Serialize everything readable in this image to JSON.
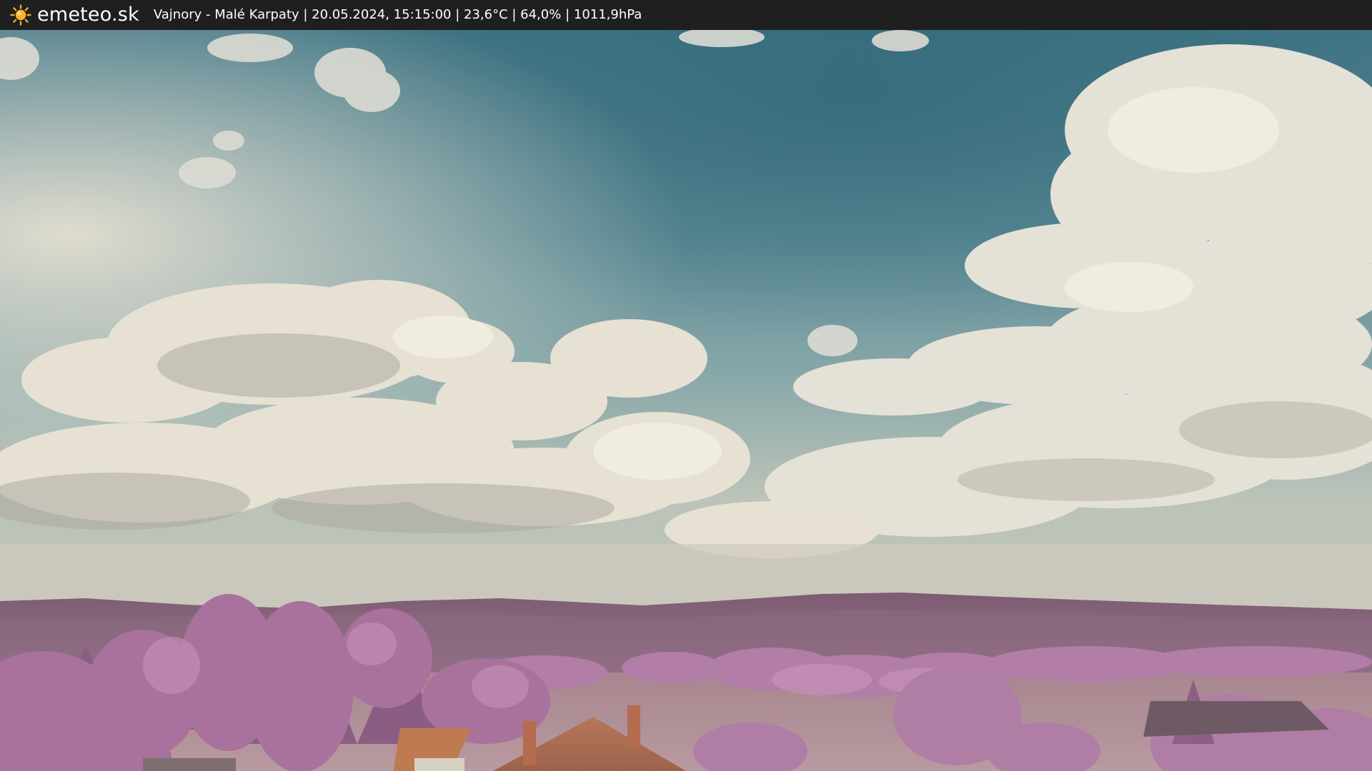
{
  "header": {
    "brand": "emeteo.sk",
    "logo_icon": "sun-icon",
    "caption": "Vajnory - Malé Karpaty | 20.05.2024, 15:15:00 | 23,6°C | 64,0% | 1011,9hPa"
  },
  "colors": {
    "header_bg": "#1f1f1f",
    "sun": "#f5a623",
    "sky_top": "#3f7484",
    "sky_mid": "#6f9aa3",
    "cloud": "#e9e4d3",
    "hills": "#7c5a72",
    "foliage": "#b27da6",
    "roof": "#c07a52"
  }
}
